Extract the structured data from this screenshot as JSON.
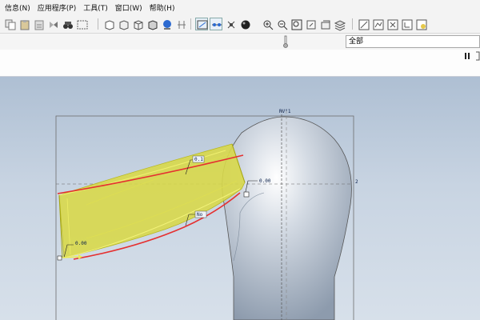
{
  "menu": {
    "items": [
      "信息(N)",
      "应用程序(P)",
      "工具(T)",
      "窗口(W)",
      "帮助(H)"
    ]
  },
  "toolbar": {
    "left_icons": [
      "copy-icon",
      "paste-icon",
      "paste-special-icon",
      "mirror-icon",
      "find-icon",
      "select-box-icon"
    ],
    "mid_icons": [
      "cube-shaded-icon",
      "cube-hidden-icon",
      "cube-wire-icon",
      "cube-solid-icon",
      "display-style-icon",
      "regen-icon"
    ],
    "view_icons": [
      "datum-plane-icon",
      "datum-axis-icon",
      "datum-point-icon",
      "sphere-icon",
      "zoom-in-icon",
      "zoom-out-icon",
      "refit-icon",
      "orient-icon",
      "saved-views-icon",
      "layers-icon"
    ],
    "right_icons": [
      "sketch-icon",
      "sketch-display-icon",
      "sketch-xy-icon",
      "sketch-coord-icon",
      "sketch-render-icon"
    ]
  },
  "filter": {
    "value": "全部"
  },
  "dimensions": {
    "d1": "0.1",
    "d2": "0.00",
    "d3": "No",
    "d4": "0.00",
    "plane_label": "RV°1",
    "axis_label": "2"
  },
  "colors": {
    "viewport_top": "#aebfd3",
    "viewport_bottom": "#d7e0ea",
    "sweep_fill": "#d8d84a",
    "sweep_edge": "#e6e64c",
    "trajectory": "#e53030",
    "body_shade": "#9aa8b8"
  }
}
